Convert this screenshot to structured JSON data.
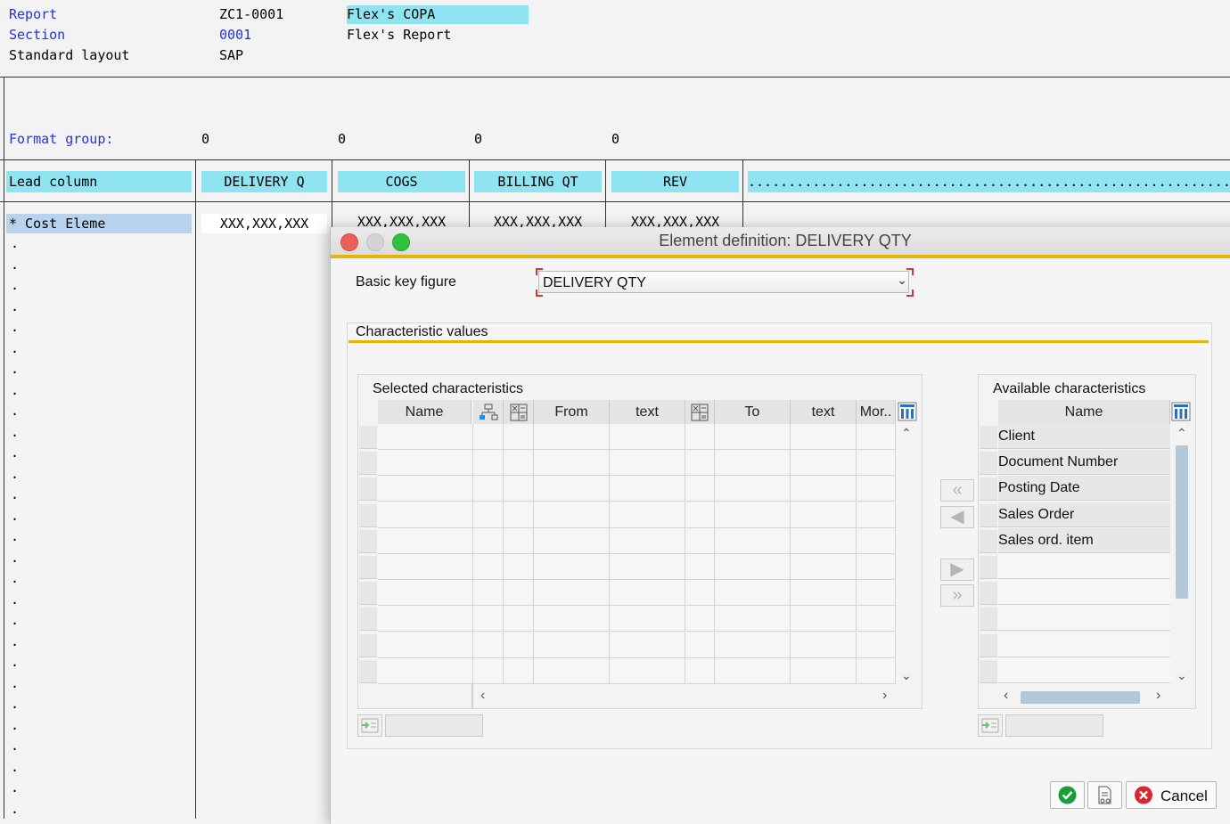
{
  "header": {
    "report_label": "Report",
    "report_value": "ZC1-0001",
    "report_desc": "Flex's COPA",
    "section_label": "Section",
    "section_value": "0001",
    "section_desc": "Flex's Report",
    "layout_label": "Standard layout",
    "layout_value": "SAP"
  },
  "format_group": {
    "label": "Format group:",
    "values": [
      "0",
      "0",
      "0",
      "0"
    ]
  },
  "columns": {
    "lead": "Lead column",
    "headers": [
      "DELIVERY Q",
      "COGS",
      "BILLING QT",
      "REV"
    ],
    "dotted": "..............................................................",
    "first_row_label": "* Cost Eleme",
    "first_row_values": [
      "XXX,XXX,XXX",
      "XXX,XXX,XXX",
      "XXX,XXX,XXX",
      "XXX,XXX,XXX"
    ],
    "dot_char": "."
  },
  "dialog": {
    "title": "Element definition: DELIVERY QTY",
    "basic_key_label": "Basic key figure",
    "basic_key_value": "DELIVERY QTY",
    "char_values_title": "Characteristic values",
    "selected": {
      "title": "Selected characteristics",
      "headers": [
        "Name",
        "",
        "",
        "From",
        "text",
        "",
        "To",
        "text",
        "Mor.."
      ]
    },
    "available": {
      "title": "Available characteristics",
      "header": "Name",
      "items": [
        "Client",
        "Document Number",
        "Posting Date",
        "Sales Order",
        "Sales ord. item"
      ]
    },
    "buttons": {
      "cancel": "Cancel"
    }
  },
  "colors": {
    "accent_yellow": "#e4b40b",
    "header_cyan": "#8ee4f0",
    "link_blue": "#2233dd",
    "ok_green": "#1a9e3a",
    "cancel_red": "#d9262f"
  }
}
